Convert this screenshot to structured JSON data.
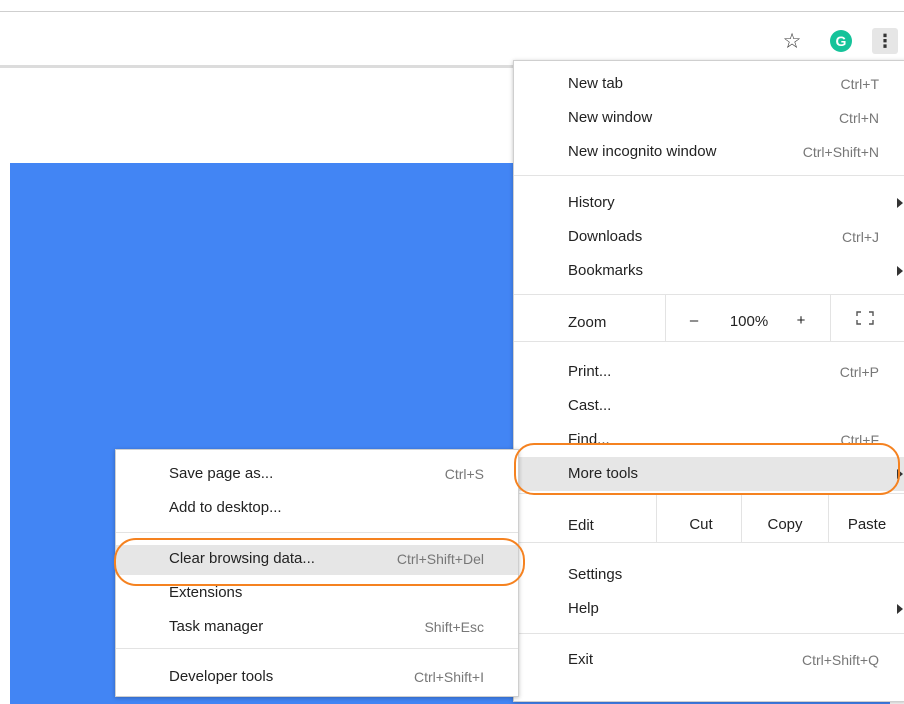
{
  "toolbar": {
    "star_icon": "☆",
    "grammarly_icon": "G",
    "menu_icon": "⋮"
  },
  "colors": {
    "page_background": "#4285f4",
    "highlight_ring": "#f58220",
    "grammarly": "#15c39a"
  },
  "main_menu": {
    "new_tab": {
      "label": "New tab",
      "shortcut": "Ctrl+T"
    },
    "new_window": {
      "label": "New window",
      "shortcut": "Ctrl+N"
    },
    "new_incognito": {
      "label": "New incognito window",
      "shortcut": "Ctrl+Shift+N"
    },
    "history": {
      "label": "History"
    },
    "downloads": {
      "label": "Downloads",
      "shortcut": "Ctrl+J"
    },
    "bookmarks": {
      "label": "Bookmarks"
    },
    "zoom": {
      "label": "Zoom",
      "minus": "–",
      "value": "100%",
      "plus": "+"
    },
    "print": {
      "label": "Print...",
      "shortcut": "Ctrl+P"
    },
    "cast": {
      "label": "Cast..."
    },
    "find": {
      "label": "Find...",
      "shortcut": "Ctrl+F"
    },
    "more_tools": {
      "label": "More tools"
    },
    "edit": {
      "label": "Edit",
      "cut": "Cut",
      "copy": "Copy",
      "paste": "Paste"
    },
    "settings": {
      "label": "Settings"
    },
    "help": {
      "label": "Help"
    },
    "exit": {
      "label": "Exit",
      "shortcut": "Ctrl+Shift+Q"
    }
  },
  "sub_menu": {
    "save_page": {
      "label": "Save page as...",
      "shortcut": "Ctrl+S"
    },
    "add_desktop": {
      "label": "Add to desktop..."
    },
    "clear_data": {
      "label": "Clear browsing data...",
      "shortcut": "Ctrl+Shift+Del"
    },
    "extensions": {
      "label": "Extensions"
    },
    "task_manager": {
      "label": "Task manager",
      "shortcut": "Shift+Esc"
    },
    "dev_tools": {
      "label": "Developer tools",
      "shortcut": "Ctrl+Shift+I"
    }
  }
}
